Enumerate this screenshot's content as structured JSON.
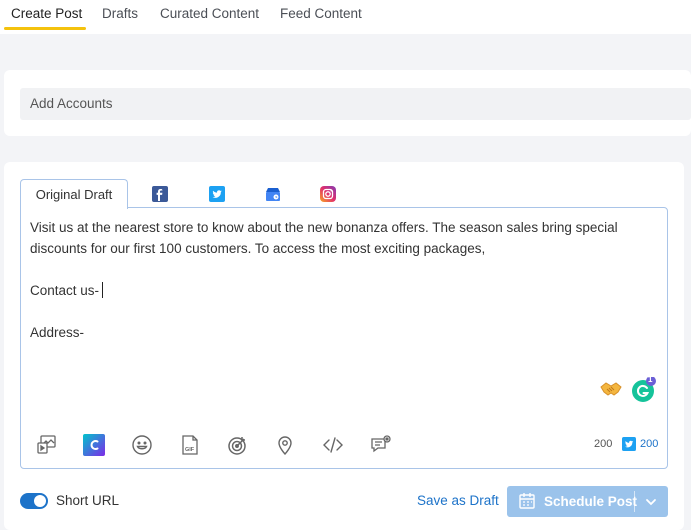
{
  "tabs": [
    {
      "label": "Create Post",
      "active": true
    },
    {
      "label": "Drafts",
      "active": false
    },
    {
      "label": "Curated Content",
      "active": false
    },
    {
      "label": "Feed Content",
      "active": false
    }
  ],
  "accounts": {
    "placeholder": "Add Accounts"
  },
  "editor": {
    "draft_tab_label": "Original Draft",
    "network_tabs": [
      "facebook-icon",
      "twitter-icon",
      "google-business-icon",
      "instagram-icon"
    ],
    "paragraph1": "Visit us at the nearest store to know about the new bonanza offers. The season sales bring special discounts for our first 100 customers. To access the most exciting packages,",
    "paragraph2": "Contact us-",
    "paragraph3": "Address-",
    "grammarly_badge": "1",
    "char_count": "200",
    "twitter_count": "200",
    "toolbar_icons": [
      "media-library-icon",
      "canva-icon",
      "emoji-icon",
      "gif-icon",
      "target-icon",
      "location-icon",
      "code-icon",
      "comment-settings-icon"
    ]
  },
  "footer": {
    "short_url_label": "Short URL",
    "short_url_enabled": true,
    "save_draft_label": "Save as Draft",
    "schedule_label": "Schedule Post"
  },
  "colors": {
    "accent": "#1d73c9",
    "tab_underline": "#f4c20d",
    "schedule_button": "#9bc3eb"
  }
}
